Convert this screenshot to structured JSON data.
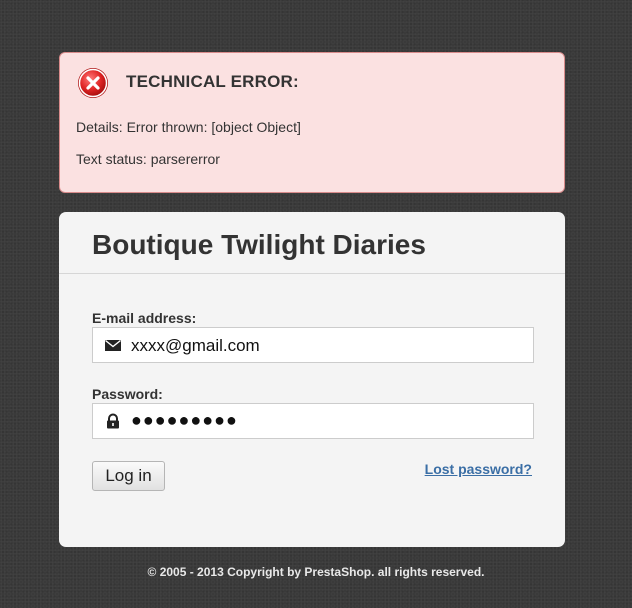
{
  "error": {
    "title": "TECHNICAL ERROR:",
    "details": "Details: Error thrown: [object Object]",
    "status": "Text status: parsererror",
    "icon": "error-circle-x-icon",
    "background_color": "#fbe1e1",
    "border_color": "#d98b8b"
  },
  "login": {
    "shop_name": "Boutique Twilight Diaries",
    "email_label": "E-mail address:",
    "email_value": "xxxx@gmail.com",
    "email_icon": "envelope-icon",
    "password_label": "Password:",
    "password_value": "●●●●●●●●●",
    "password_icon": "lock-icon",
    "login_button_label": "Log in",
    "lost_password_link": "Lost password?",
    "link_color": "#3a6ea5"
  },
  "footer": {
    "copyright": "© 2005 - 2013 Copyright by PrestaShop. all rights reserved."
  }
}
